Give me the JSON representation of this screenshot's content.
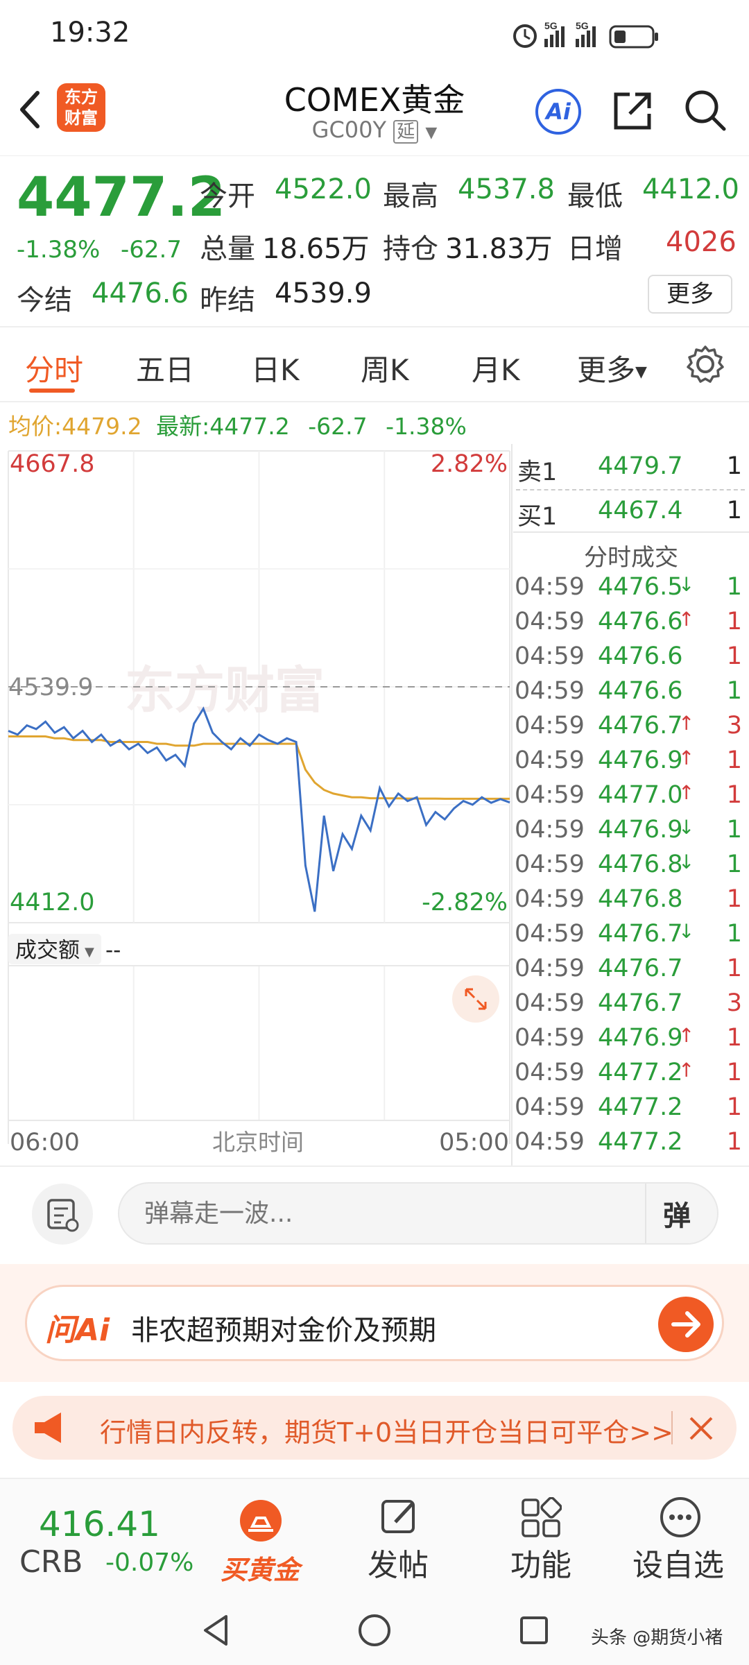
{
  "status_bar": {
    "time": "19:32",
    "net1": "5G",
    "net2": "5G"
  },
  "header": {
    "logo_text_1": "东方",
    "logo_text_2": "财富",
    "title": "COMEX黄金",
    "code": "GC00Y",
    "delay_tag": "延",
    "ai_label": "Ai"
  },
  "quote": {
    "last": "4477.2",
    "change_pct": "-1.38%",
    "change": "-62.7",
    "open_label": "今开",
    "open": "4522.0",
    "high_label": "最高",
    "high": "4537.8",
    "low_label": "最低",
    "low": "4412.0",
    "volume_label": "总量",
    "volume": "18.65万",
    "oi_label": "持仓",
    "oi": "31.83万",
    "daily_inc_label": "日增",
    "daily_inc": "4026",
    "settle_label": "今结",
    "settle": "4476.6",
    "prev_settle_label": "昨结",
    "prev_settle": "4539.9",
    "more_button": "更多"
  },
  "tabs": [
    "分时",
    "五日",
    "日K",
    "周K",
    "月K",
    "更多"
  ],
  "active_tab": "分时",
  "info_line": {
    "avg_label": "均价:",
    "avg": "4479.2",
    "latest_label": "最新:",
    "latest": "4477.2",
    "chg": "-62.7",
    "pct": "-1.38%"
  },
  "chart": {
    "y_max": "4667.8",
    "y_min": "4412.0",
    "pct_max": "2.82%",
    "pct_min": "-2.82%",
    "ref_price": "4539.9",
    "watermark": "东方财富",
    "volume_label": "成交额",
    "volume_value": "--",
    "x_start": "06:00",
    "x_mid": "北京时间",
    "x_end": "05:00"
  },
  "chart_data": {
    "type": "line",
    "title": "",
    "ylim": [
      4412.0,
      4667.8
    ],
    "reference": 4539.9,
    "series": [
      {
        "name": "",
        "values": [
          4516,
          4514,
          4519,
          4517,
          4521,
          4515,
          4518,
          4512,
          4516,
          4510,
          4514,
          4508,
          4511,
          4506,
          4509,
          4504,
          4507,
          4500,
          4503,
          4497,
          4520,
          4528,
          4515,
          4510,
          4506,
          4512,
          4508,
          4514,
          4511,
          4509,
          4512,
          4510,
          4443,
          4418,
          4470,
          4440,
          4460,
          4452,
          4470,
          4462,
          4485,
          4475,
          4482,
          4478,
          4480,
          4465,
          4472,
          4468,
          4474,
          4478,
          4476,
          4480,
          4477,
          4479,
          4477.2
        ]
      },
      {
        "name": "",
        "values": [
          4513,
          4513,
          4513,
          4513,
          4513,
          4512,
          4512,
          4511,
          4511,
          4511,
          4511,
          4510,
          4510,
          4510,
          4510,
          4510,
          4509,
          4509,
          4508,
          4508,
          4508,
          4509,
          4509,
          4509,
          4509,
          4509,
          4509,
          4509,
          4509,
          4509,
          4509,
          4509,
          4495,
          4488,
          4484,
          4482,
          4481,
          4480,
          4480,
          4479.5,
          4479.5,
          4479.4,
          4479.4,
          4479.3,
          4479.3,
          4479.3,
          4479.3,
          4479.2,
          4479.2,
          4479.2,
          4479.2,
          4479.2,
          4479.2,
          4479.2,
          4479.2
        ]
      }
    ]
  },
  "order_book": [
    {
      "label": "卖1",
      "price": "4479.7",
      "vol": "1"
    },
    {
      "label": "买1",
      "price": "4467.4",
      "vol": "1"
    }
  ],
  "trades_title": "分时成交",
  "trades": [
    {
      "time": "04:59",
      "price": "4476.5",
      "dir": "↓",
      "vol": "1",
      "color": "green"
    },
    {
      "time": "04:59",
      "price": "4476.6",
      "dir": "↑",
      "vol": "1",
      "color": "red"
    },
    {
      "time": "04:59",
      "price": "4476.6",
      "dir": "",
      "vol": "1",
      "color": "red"
    },
    {
      "time": "04:59",
      "price": "4476.6",
      "dir": "",
      "vol": "1",
      "color": "green"
    },
    {
      "time": "04:59",
      "price": "4476.7",
      "dir": "↑",
      "vol": "3",
      "color": "red"
    },
    {
      "time": "04:59",
      "price": "4476.9",
      "dir": "↑",
      "vol": "1",
      "color": "red"
    },
    {
      "time": "04:59",
      "price": "4477.0",
      "dir": "↑",
      "vol": "1",
      "color": "red"
    },
    {
      "time": "04:59",
      "price": "4476.9",
      "dir": "↓",
      "vol": "1",
      "color": "green"
    },
    {
      "time": "04:59",
      "price": "4476.8",
      "dir": "↓",
      "vol": "1",
      "color": "green"
    },
    {
      "time": "04:59",
      "price": "4476.8",
      "dir": "",
      "vol": "1",
      "color": "red"
    },
    {
      "time": "04:59",
      "price": "4476.7",
      "dir": "↓",
      "vol": "1",
      "color": "green"
    },
    {
      "time": "04:59",
      "price": "4476.7",
      "dir": "",
      "vol": "1",
      "color": "red"
    },
    {
      "time": "04:59",
      "price": "4476.7",
      "dir": "",
      "vol": "3",
      "color": "red"
    },
    {
      "time": "04:59",
      "price": "4476.9",
      "dir": "↑",
      "vol": "1",
      "color": "red"
    },
    {
      "time": "04:59",
      "price": "4477.2",
      "dir": "↑",
      "vol": "1",
      "color": "red"
    },
    {
      "time": "04:59",
      "price": "4477.2",
      "dir": "",
      "vol": "1",
      "color": "red"
    },
    {
      "time": "04:59",
      "price": "4477.2",
      "dir": "",
      "vol": "1",
      "color": "red"
    }
  ],
  "danmaku": {
    "placeholder": "弹幕走一波...",
    "send_label": "弹"
  },
  "ai_banner": {
    "brand": "问Ai",
    "text": "非农超预期对金价及预期"
  },
  "promo": {
    "text": "行情日内反转，期货T+0当日开仓当日可平仓>>"
  },
  "bottom_nav": {
    "index_value": "416.41",
    "index_name": "CRB",
    "index_change": "-0.07%",
    "buy_gold": "买黄金",
    "post": "发帖",
    "functions": "功能",
    "watchlist": "设自选"
  },
  "watermark_footer": "头条 @期货小褚",
  "colors": {
    "up": "#d23b3b",
    "down": "#2a9d3a",
    "accent": "#f05a24",
    "line": "#3b6fc4",
    "avg": "#e0a530"
  }
}
